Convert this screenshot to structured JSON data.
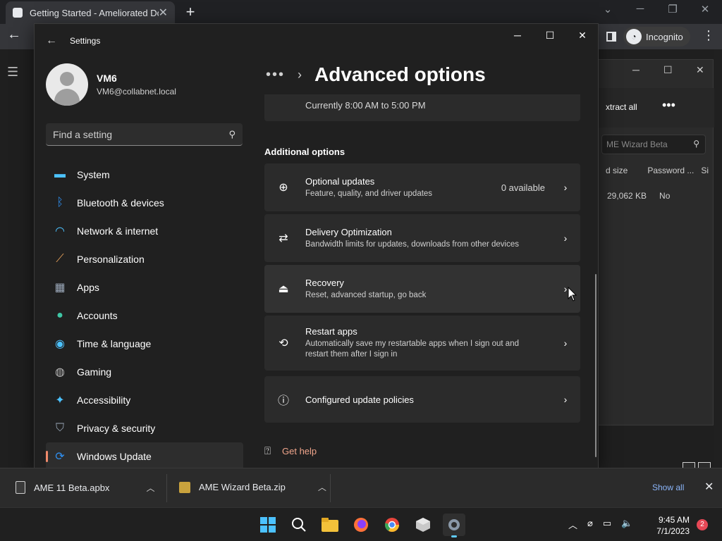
{
  "browser": {
    "tab_title": "Getting Started - Ameliorated Do",
    "tab_close": "✕",
    "new_tab": "+",
    "incognito_label": "Incognito"
  },
  "explorer": {
    "extract_all": "xtract all",
    "more": "•••",
    "search_placeholder": "ME Wizard Beta",
    "col_size": "d size",
    "col_password": "Password ...",
    "col_si": "Si",
    "row_size": "29,062 KB",
    "row_password": "No"
  },
  "settings": {
    "window_title": "Settings",
    "user": {
      "name": "VM6",
      "email": "VM6@collabnet.local"
    },
    "search_placeholder": "Find a setting",
    "nav": [
      {
        "label": "System",
        "icon": "monitor-icon",
        "color": "#4cc2ff"
      },
      {
        "label": "Bluetooth & devices",
        "icon": "bluetooth-icon",
        "color": "#2f8ff0"
      },
      {
        "label": "Network & internet",
        "icon": "wifi-icon",
        "color": "#4cc2ff"
      },
      {
        "label": "Personalization",
        "icon": "brush-icon",
        "color": "#e8a25a"
      },
      {
        "label": "Apps",
        "icon": "apps-icon",
        "color": "#9aa7b8"
      },
      {
        "label": "Accounts",
        "icon": "person-icon",
        "color": "#3fc6a5"
      },
      {
        "label": "Time & language",
        "icon": "globe-clock-icon",
        "color": "#4cc2ff"
      },
      {
        "label": "Gaming",
        "icon": "gamepad-icon",
        "color": "#b8b8b8"
      },
      {
        "label": "Accessibility",
        "icon": "accessibility-icon",
        "color": "#4cc2ff"
      },
      {
        "label": "Privacy & security",
        "icon": "shield-icon",
        "color": "#9aa7b8"
      },
      {
        "label": "Windows Update",
        "icon": "update-icon",
        "color": "#2f8ff0",
        "active": true
      }
    ],
    "breadcrumb_more": "•••",
    "page_title": "Advanced options",
    "active_hours_text": "Currently 8:00 AM to 5:00 PM",
    "section_title": "Additional options",
    "options": [
      {
        "title": "Optional updates",
        "subtitle": "Feature, quality, and driver updates",
        "value": "0 available",
        "icon": "plus-circle-icon"
      },
      {
        "title": "Delivery Optimization",
        "subtitle": "Bandwidth limits for updates, downloads from other devices",
        "value": "",
        "icon": "delivery-icon"
      },
      {
        "title": "Recovery",
        "subtitle": "Reset, advanced startup, go back",
        "value": "",
        "icon": "recovery-icon"
      },
      {
        "title": "Restart apps",
        "subtitle": "Automatically save my restartable apps when I sign out and restart them after I sign in",
        "value": "",
        "icon": "restart-apps-icon"
      },
      {
        "title": "Configured update policies",
        "subtitle": "",
        "value": "",
        "icon": "policy-icon"
      }
    ],
    "get_help": "Get help"
  },
  "downloads": {
    "items": [
      {
        "name": "AME 11 Beta.apbx"
      },
      {
        "name": "AME Wizard Beta.zip"
      }
    ],
    "show_all": "Show all"
  },
  "taskbar": {
    "time": "9:45 AM",
    "date": "7/1/2023",
    "notifications": "2"
  }
}
